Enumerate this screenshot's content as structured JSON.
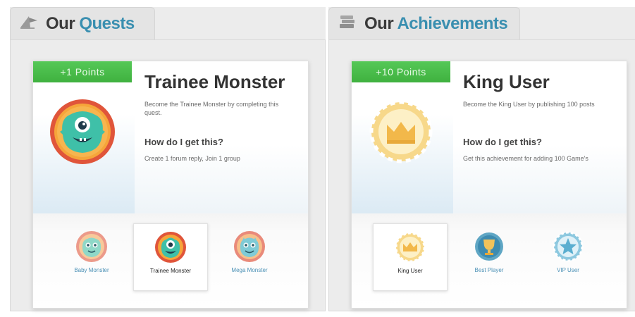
{
  "quests_panel": {
    "title_word1": "Our",
    "title_word2": "Quests",
    "icon": "flag-pennant-icon",
    "points": "+1 Points",
    "featured_title": "Trainee Monster",
    "description": "Become the Trainee Monster by completing this quest.",
    "how_heading": "How do I get this?",
    "how_text": "Create 1 forum reply, Join 1 group",
    "badges": [
      {
        "label": "Baby Monster",
        "icon": "baby-monster-icon",
        "selected": false
      },
      {
        "label": "Trainee Monster",
        "icon": "trainee-monster-icon",
        "selected": true
      },
      {
        "label": "Mega Monster",
        "icon": "mega-monster-icon",
        "selected": false
      }
    ]
  },
  "achievements_panel": {
    "title_word1": "Our",
    "title_word2": "Achievements",
    "icon": "trophy-stack-icon",
    "points": "+10 Points",
    "featured_title": "King User",
    "description": "Become the King User by publishing 100 posts",
    "how_heading": "How do I get this?",
    "how_text": "Get this achievement for adding 100 Game's",
    "badges": [
      {
        "label": "King User",
        "icon": "crown-badge-icon",
        "selected": true
      },
      {
        "label": "Best Player",
        "icon": "trophy-badge-icon",
        "selected": false
      },
      {
        "label": "VIP User",
        "icon": "star-badge-icon",
        "selected": false
      }
    ]
  },
  "colors": {
    "accent_blue": "#3a8fb0",
    "points_green": "#45b845",
    "monster_teal": "#3fc0a8",
    "monster_ring": "#e0553a",
    "crown_gold": "#f2c25a"
  }
}
